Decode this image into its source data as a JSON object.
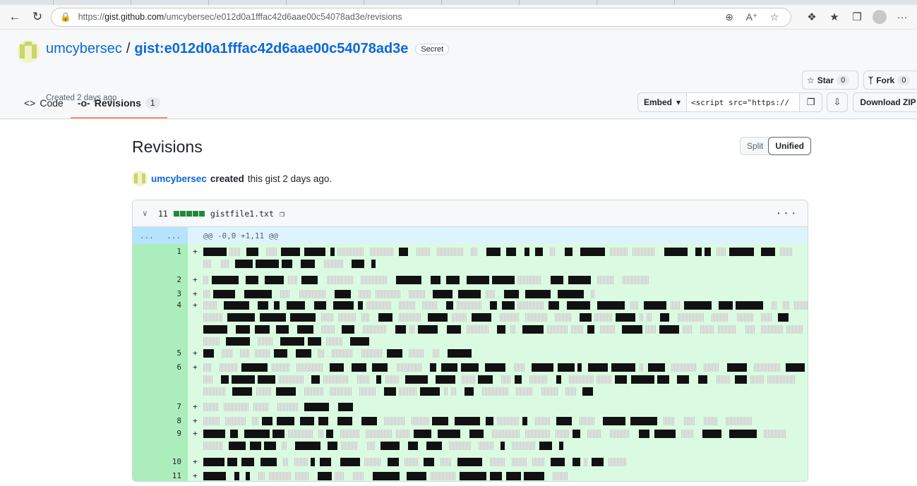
{
  "browser": {
    "url_prefix": "https://",
    "url_host": "gist.github.com",
    "url_path": "/umcybersec/e012d0a1fffac42d6aae00c54078ad3e/revisions"
  },
  "header": {
    "owner": "umcybersec",
    "separator": "/",
    "gist_name": "gist:e012d0a1fffac42d6aae00c54078ad3e",
    "visibility_badge": "Secret",
    "created": "Created 2 days ago",
    "star_label": "Star",
    "star_count": "0",
    "fork_label": "Fork",
    "fork_count": "0"
  },
  "tabs": [
    {
      "label": "Code"
    },
    {
      "label": "Revisions",
      "count": "1"
    }
  ],
  "toolbar": {
    "embed_label": "Embed",
    "embed_value": "<script src=\"https://",
    "download_label": "Download ZIP"
  },
  "main": {
    "title": "Revisions",
    "split_label": "Split",
    "unified_label": "Unified",
    "created_user": "umcybersec",
    "created_verb": "created",
    "created_rest": "this gist 2 days ago."
  },
  "file": {
    "additions": "11",
    "filename": "gistfile1.txt",
    "menu": "···",
    "hunk_left": "...",
    "hunk_right": "...",
    "hunk_header": "@@ -0,0 +1,11 @@",
    "lines": [
      "1",
      "2",
      "3",
      "4",
      "5",
      "6",
      "7",
      "8",
      "9",
      "10",
      "11"
    ],
    "marker": "+"
  },
  "colors": {
    "link": "#0969da",
    "added_bg": "#dafbe1",
    "added_gutter": "#aceebb",
    "hunk_bg": "#ddf4ff",
    "tab_underline": "#fd8c73"
  }
}
